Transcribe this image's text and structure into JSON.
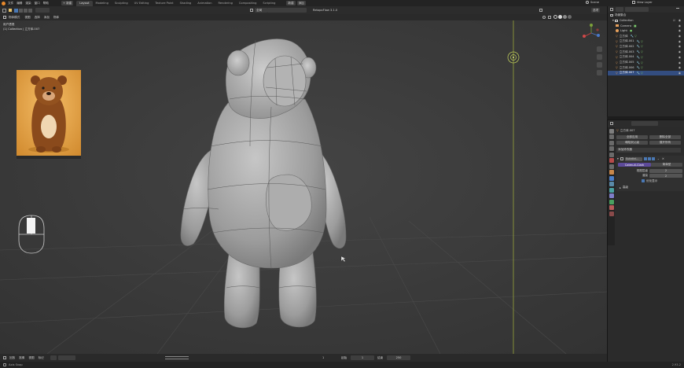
{
  "topbar": {
    "menus": [
      "文件",
      "编辑",
      "渲染",
      "窗口",
      "帮助"
    ],
    "workspaces": [
      "Layout",
      "Modeling",
      "Sculpting",
      "UV Editing",
      "Texture Paint",
      "Shading",
      "Animation",
      "Rendering",
      "Compositing",
      "Scripting"
    ],
    "active_workspace": "Layout",
    "extra_chips": [
      "新建",
      "添加",
      "+ 新建"
    ],
    "scene_label": "Scene",
    "view_layer_label": "View Layer"
  },
  "viewport_header": {
    "mode": "物体模式",
    "menus": [
      "视图",
      "选择",
      "添加",
      "物体"
    ],
    "transform_orientation": "全局",
    "pivot_hint": "RetopoFlow 3.1.0",
    "options_label": "选项"
  },
  "viewport": {
    "view_name": "用户透视",
    "collection_path": "(1) Collection | 立方体.007"
  },
  "outliner": {
    "title": "场景集合",
    "items": [
      {
        "name": "Collection",
        "kind": "collection"
      },
      {
        "name": "Camera",
        "kind": "camera"
      },
      {
        "name": "Light",
        "kind": "light"
      },
      {
        "name": "立方体",
        "kind": "mesh"
      },
      {
        "name": "立方体.001",
        "kind": "mesh"
      },
      {
        "name": "立方体.002",
        "kind": "mesh"
      },
      {
        "name": "立方体.003",
        "kind": "mesh"
      },
      {
        "name": "立方体.004",
        "kind": "mesh"
      },
      {
        "name": "立方体.005",
        "kind": "mesh"
      },
      {
        "name": "立方体.006",
        "kind": "mesh"
      },
      {
        "name": "立方体.007",
        "kind": "mesh"
      }
    ]
  },
  "properties": {
    "object_name": "立方体.007",
    "buttons_row1": [
      "全部应用",
      "删除全部"
    ],
    "buttons_row2": [
      "塌陷到父级",
      "展开所有"
    ],
    "add_modifier": "添加修改器",
    "modifier_name": "Subdivi...",
    "mode_active": "Catmull-Clark",
    "mode_other": "简单型",
    "levels_viewport_label": "视图层级",
    "levels_viewport_value": "2",
    "render_label": "渲染",
    "render_value": "2",
    "optimal_display_label": "优化显示",
    "advanced_label": "高级"
  },
  "timeline": {
    "menus": [
      "回放",
      "抠像",
      "视图",
      "标记"
    ],
    "frame_start_label": "起始",
    "frame_end_label": "结束",
    "current_frame": "1",
    "start": "1",
    "end": "250"
  },
  "statusbar": {
    "left_hint": "Axis Snap",
    "right_version": "2.93.2"
  },
  "colors": {
    "accent_blue": "#3d6ea8",
    "active_purple": "#5d4a9a",
    "mesh_orange": "#e7a05b",
    "axis_green": "#98a53a",
    "viewport_bg": "#3a3a3a"
  }
}
